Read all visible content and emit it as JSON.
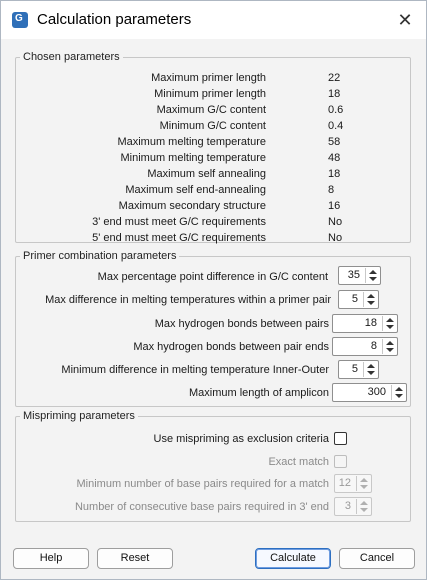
{
  "window": {
    "title": "Calculation parameters",
    "close_glyph": "✕"
  },
  "chosen": {
    "legend": "Chosen parameters",
    "rows": [
      {
        "label": "Maximum primer length",
        "value": "22"
      },
      {
        "label": "Minimum primer length",
        "value": "18"
      },
      {
        "label": "Maximum G/C content",
        "value": "0.6"
      },
      {
        "label": "Minimum G/C content",
        "value": "0.4"
      },
      {
        "label": "Maximum melting temperature",
        "value": "58"
      },
      {
        "label": "Minimum melting temperature",
        "value": "48"
      },
      {
        "label": "Maximum self annealing",
        "value": "18"
      },
      {
        "label": "Maximum self end-annealing",
        "value": "8"
      },
      {
        "label": "Maximum secondary structure",
        "value": "16"
      },
      {
        "label": "3' end must meet G/C requirements",
        "value": "No"
      },
      {
        "label": "5' end must meet G/C requirements",
        "value": "No"
      }
    ]
  },
  "combination": {
    "legend": "Primer combination parameters",
    "rows": [
      {
        "label": "Max percentage point difference in G/C content",
        "value": "35"
      },
      {
        "label": "Max difference in melting temperatures within a primer pair",
        "value": "5"
      },
      {
        "label": "Max hydrogen bonds between pairs",
        "value": "18"
      },
      {
        "label": "Max hydrogen bonds between pair ends",
        "value": "8"
      },
      {
        "label": "Minimum difference in melting temperature Inner-Outer",
        "value": "5"
      },
      {
        "label": "Maximum length of amplicon",
        "value": "300"
      }
    ]
  },
  "mispriming": {
    "legend": "Mispriming parameters",
    "use_label": "Use mispriming as exclusion criteria",
    "exact_label": "Exact match",
    "min_pairs_label": "Minimum number of base pairs required for a match",
    "min_pairs_value": "12",
    "consec_label": "Number of consecutive base pairs required in 3' end",
    "consec_value": "3"
  },
  "buttons": {
    "help": "Help",
    "reset": "Reset",
    "calculate": "Calculate",
    "cancel": "Cancel"
  },
  "colors": {
    "accent": "#2d6fc1",
    "background": "#f3f3f3"
  }
}
